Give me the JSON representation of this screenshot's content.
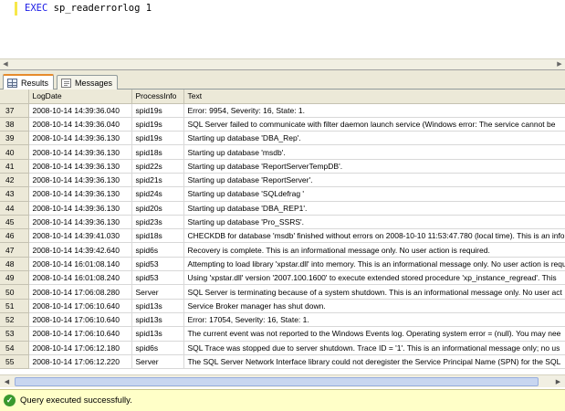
{
  "editor": {
    "query_keyword": "EXEC",
    "query_proc": "sp_readerrorlog",
    "query_arg": "1"
  },
  "tabs": [
    {
      "label": "Results",
      "icon": "grid-icon",
      "active": true
    },
    {
      "label": "Messages",
      "icon": "messages-icon",
      "active": false
    }
  ],
  "grid": {
    "columns": [
      "",
      "LogDate",
      "ProcessInfo",
      "Text"
    ],
    "rows": [
      [
        "37",
        "2008-10-14 14:39:36.040",
        "spid19s",
        "Error: 9954, Severity: 16, State: 1."
      ],
      [
        "38",
        "2008-10-14 14:39:36.040",
        "spid19s",
        "SQL Server failed to communicate with filter daemon launch service  (Windows error: The service cannot be"
      ],
      [
        "39",
        "2008-10-14 14:39:36.130",
        "spid19s",
        "Starting up database 'DBA_Rep'."
      ],
      [
        "40",
        "2008-10-14 14:39:36.130",
        "spid18s",
        "Starting up database 'msdb'."
      ],
      [
        "41",
        "2008-10-14 14:39:36.130",
        "spid22s",
        "Starting up database 'ReportServerTempDB'."
      ],
      [
        "42",
        "2008-10-14 14:39:36.130",
        "spid21s",
        "Starting up database 'ReportServer'."
      ],
      [
        "43",
        "2008-10-14 14:39:36.130",
        "spid24s",
        "Starting up database 'SQLdefrag '"
      ],
      [
        "44",
        "2008-10-14 14:39:36.130",
        "spid20s",
        "Starting up database 'DBA_REP1'."
      ],
      [
        "45",
        "2008-10-14 14:39:36.130",
        "spid23s",
        "Starting up database 'Pro_SSRS'."
      ],
      [
        "46",
        "2008-10-14 14:39:41.030",
        "spid18s",
        "CHECKDB for database 'msdb' finished without errors on 2008-10-10 11:53:47.780 (local time). This is an info"
      ],
      [
        "47",
        "2008-10-14 14:39:42.640",
        "spid6s",
        "Recovery is complete. This is an informational message only. No user action is required."
      ],
      [
        "48",
        "2008-10-14 16:01:08.140",
        "spid53",
        "Attempting to load library 'xpstar.dll' into memory. This is an informational message only. No user action is requ"
      ],
      [
        "49",
        "2008-10-14 16:01:08.240",
        "spid53",
        "Using 'xpstar.dll' version '2007.100.1600' to execute extended stored procedure 'xp_instance_regread'. This"
      ],
      [
        "50",
        "2008-10-14 17:06:08.280",
        "Server",
        "SQL Server is terminating because of a system shutdown. This is an informational message only. No user act"
      ],
      [
        "51",
        "2008-10-14 17:06:10.640",
        "spid13s",
        "Service Broker manager has shut down."
      ],
      [
        "52",
        "2008-10-14 17:06:10.640",
        "spid13s",
        "Error: 17054, Severity: 16, State: 1."
      ],
      [
        "53",
        "2008-10-14 17:06:10.640",
        "spid13s",
        "The current event was not reported to the Windows Events log. Operating system error = (null). You may nee"
      ],
      [
        "54",
        "2008-10-14 17:06:12.180",
        "spid6s",
        "SQL Trace was stopped due to server shutdown. Trace ID = '1'. This is an informational message only; no us"
      ],
      [
        "55",
        "2008-10-14 17:06:12.220",
        "Server",
        "The SQL Server Network Interface library could not deregister the Service Principal Name (SPN) for the SQL"
      ]
    ]
  },
  "status": {
    "message": "Query executed successfully.",
    "icon": "check-circle-icon",
    "background": "#ffffc8"
  }
}
